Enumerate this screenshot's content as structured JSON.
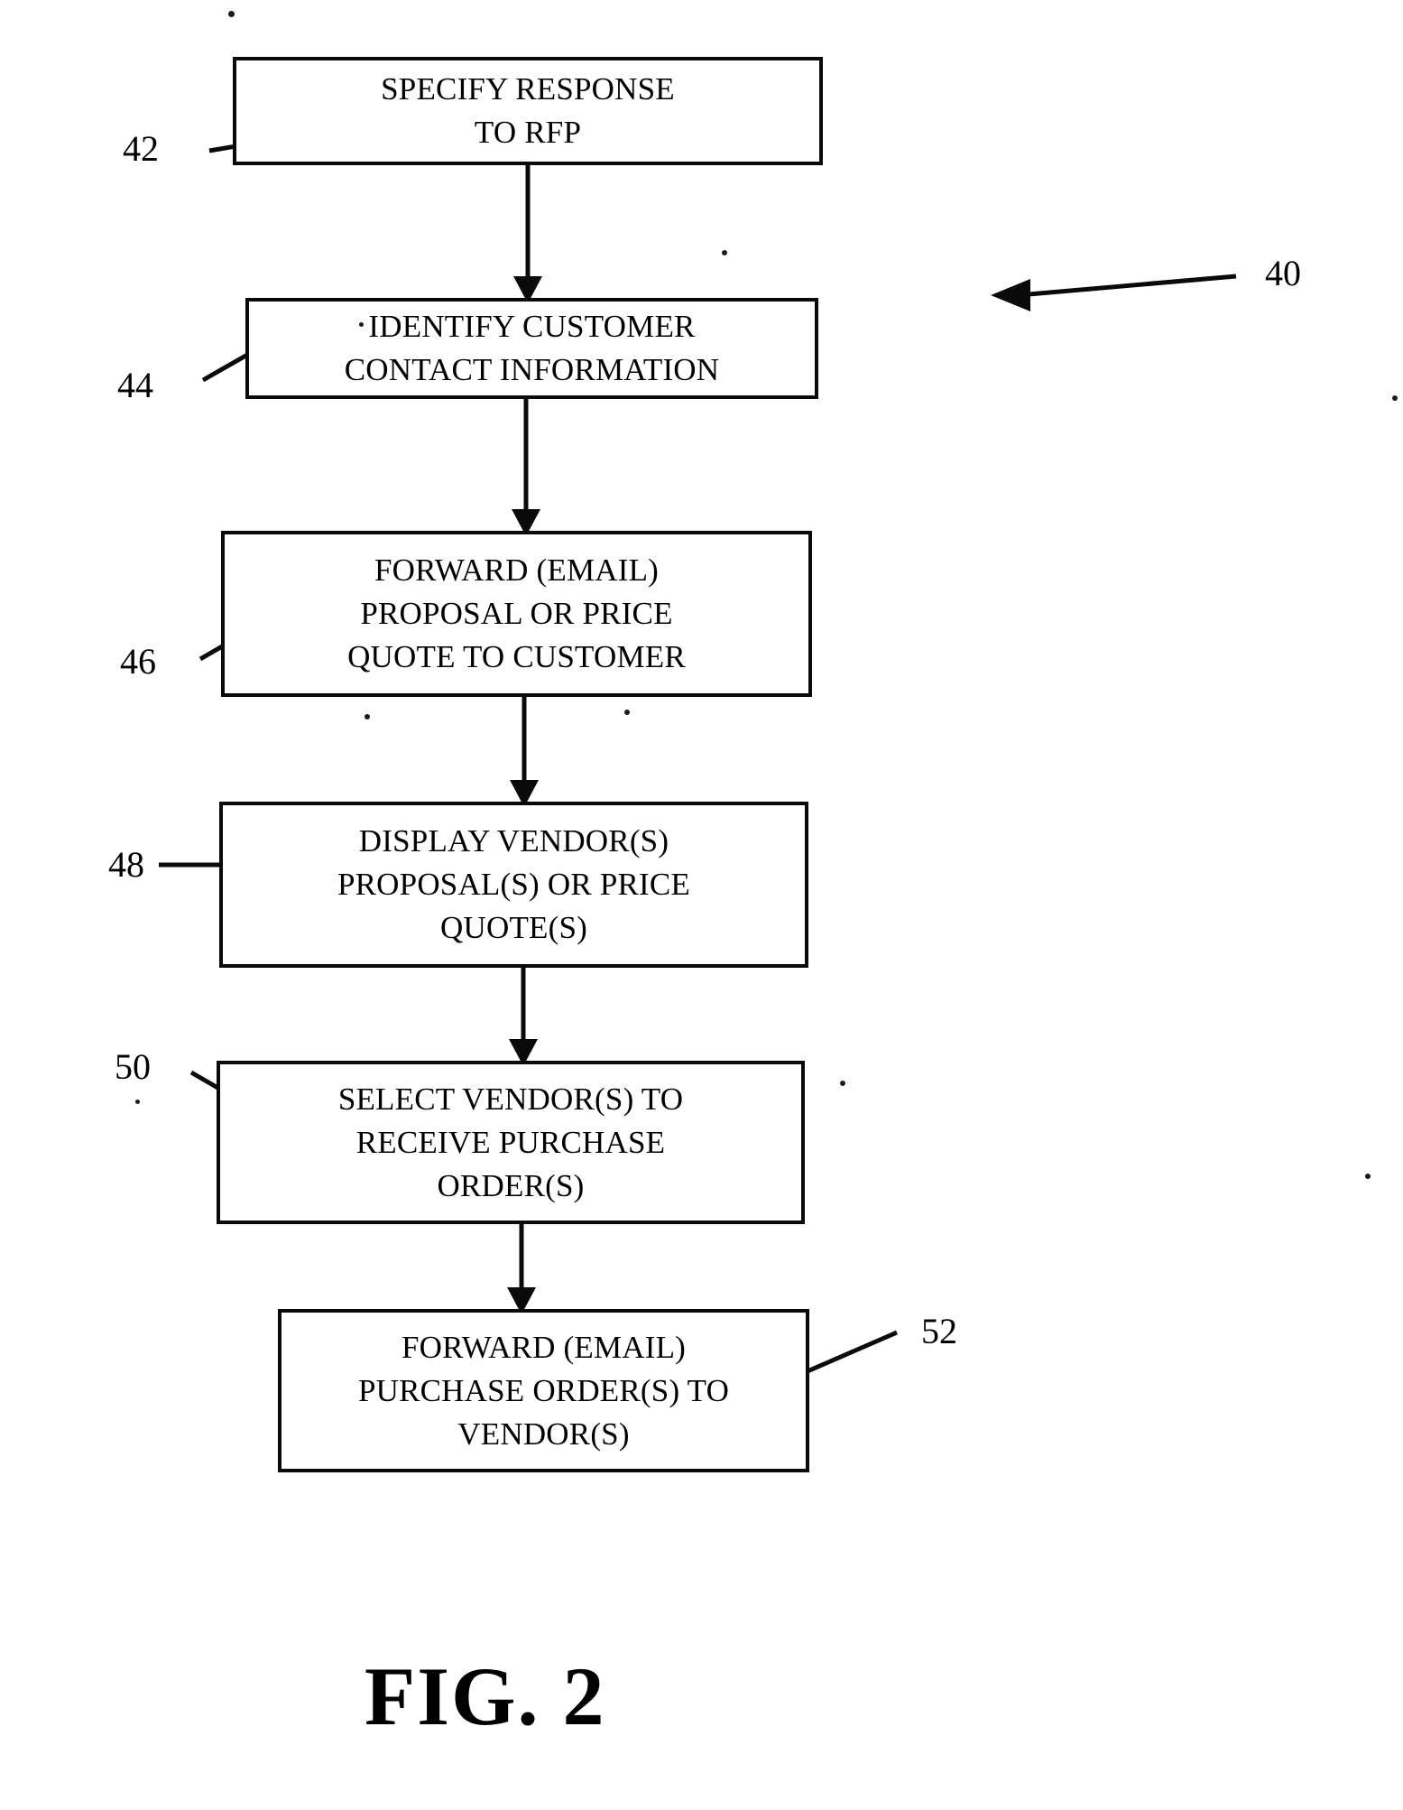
{
  "figure": {
    "caption": "FIG. 2",
    "overall_ref": "40"
  },
  "flow": {
    "steps": [
      {
        "ref": "42",
        "lines": [
          "SPECIFY RESPONSE",
          "TO RFP"
        ],
        "name": "specify-response-to-rfp"
      },
      {
        "ref": "44",
        "lines": [
          "IDENTIFY CUSTOMER",
          "CONTACT INFORMATION"
        ],
        "name": "identify-customer-contact-information"
      },
      {
        "ref": "46",
        "lines": [
          "FORWARD (EMAIL)",
          "PROPOSAL OR PRICE",
          "QUOTE TO CUSTOMER"
        ],
        "name": "forward-proposal-to-customer"
      },
      {
        "ref": "48",
        "lines": [
          "DISPLAY VENDOR(S)",
          "PROPOSAL(S) OR PRICE",
          "QUOTE(S)"
        ],
        "name": "display-vendor-proposals"
      },
      {
        "ref": "50",
        "lines": [
          "SELECT VENDOR(S) TO",
          "RECEIVE PURCHASE",
          "ORDER(S)"
        ],
        "name": "select-vendors-for-purchase-order"
      },
      {
        "ref": "52",
        "lines": [
          "FORWARD (EMAIL)",
          "PURCHASE ORDER(S) TO",
          "VENDOR(S)"
        ],
        "name": "forward-purchase-orders-to-vendors"
      }
    ]
  },
  "colors": {
    "ink": "#0a0a0a",
    "paper": "#ffffff"
  }
}
